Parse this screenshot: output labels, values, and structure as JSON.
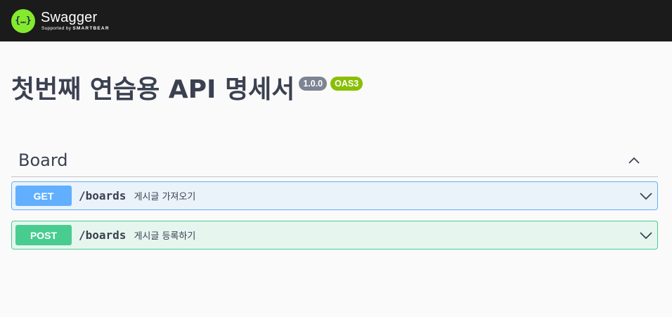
{
  "topbar": {
    "logo_glyph": "{…}",
    "brand": "Swagger",
    "supported_by": "Supported by",
    "smartbear": "SMARTBEAR"
  },
  "info": {
    "title": "첫번째 연습용 API 명세서",
    "version": "1.0.0",
    "oas": "OAS3"
  },
  "tag": {
    "name": "Board",
    "expanded": true
  },
  "operations": [
    {
      "method": "GET",
      "path": "/boards",
      "summary": "게시글 가져오기",
      "color": "#61affe"
    },
    {
      "method": "POST",
      "path": "/boards",
      "summary": "게시글 등록하기",
      "color": "#49cc90"
    }
  ]
}
